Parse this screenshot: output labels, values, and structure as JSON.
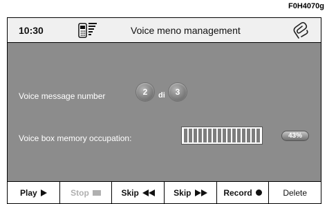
{
  "figure_code": "F0H4070g",
  "titlebar": {
    "time": "10:30",
    "title": "Voice meno management",
    "phone_icon": "phone-signal-icon",
    "clip_icon": "paperclip-icon"
  },
  "message": {
    "label": "Voice message number",
    "current": "2",
    "separator": "di",
    "total": "3"
  },
  "memory": {
    "label": "Voice box memory occupation:",
    "fill_fraction": 0.43,
    "percent_label": "43%"
  },
  "buttons": [
    {
      "label": "Play",
      "icon": "play-icon",
      "enabled": true
    },
    {
      "label": "Stop",
      "icon": "stop-icon",
      "enabled": false
    },
    {
      "label": "Skip",
      "icon": "rewind-icon",
      "enabled": true
    },
    {
      "label": "Skip",
      "icon": "fast-forward-icon",
      "enabled": true
    },
    {
      "label": "Record",
      "icon": "record-icon",
      "enabled": true
    },
    {
      "label": "Delete",
      "icon": "",
      "enabled": true
    }
  ],
  "colors": {
    "screen_background": "#8c8c8c",
    "titlebar_background": "#f0f0f0",
    "disabled_text": "#b0b0b0"
  }
}
